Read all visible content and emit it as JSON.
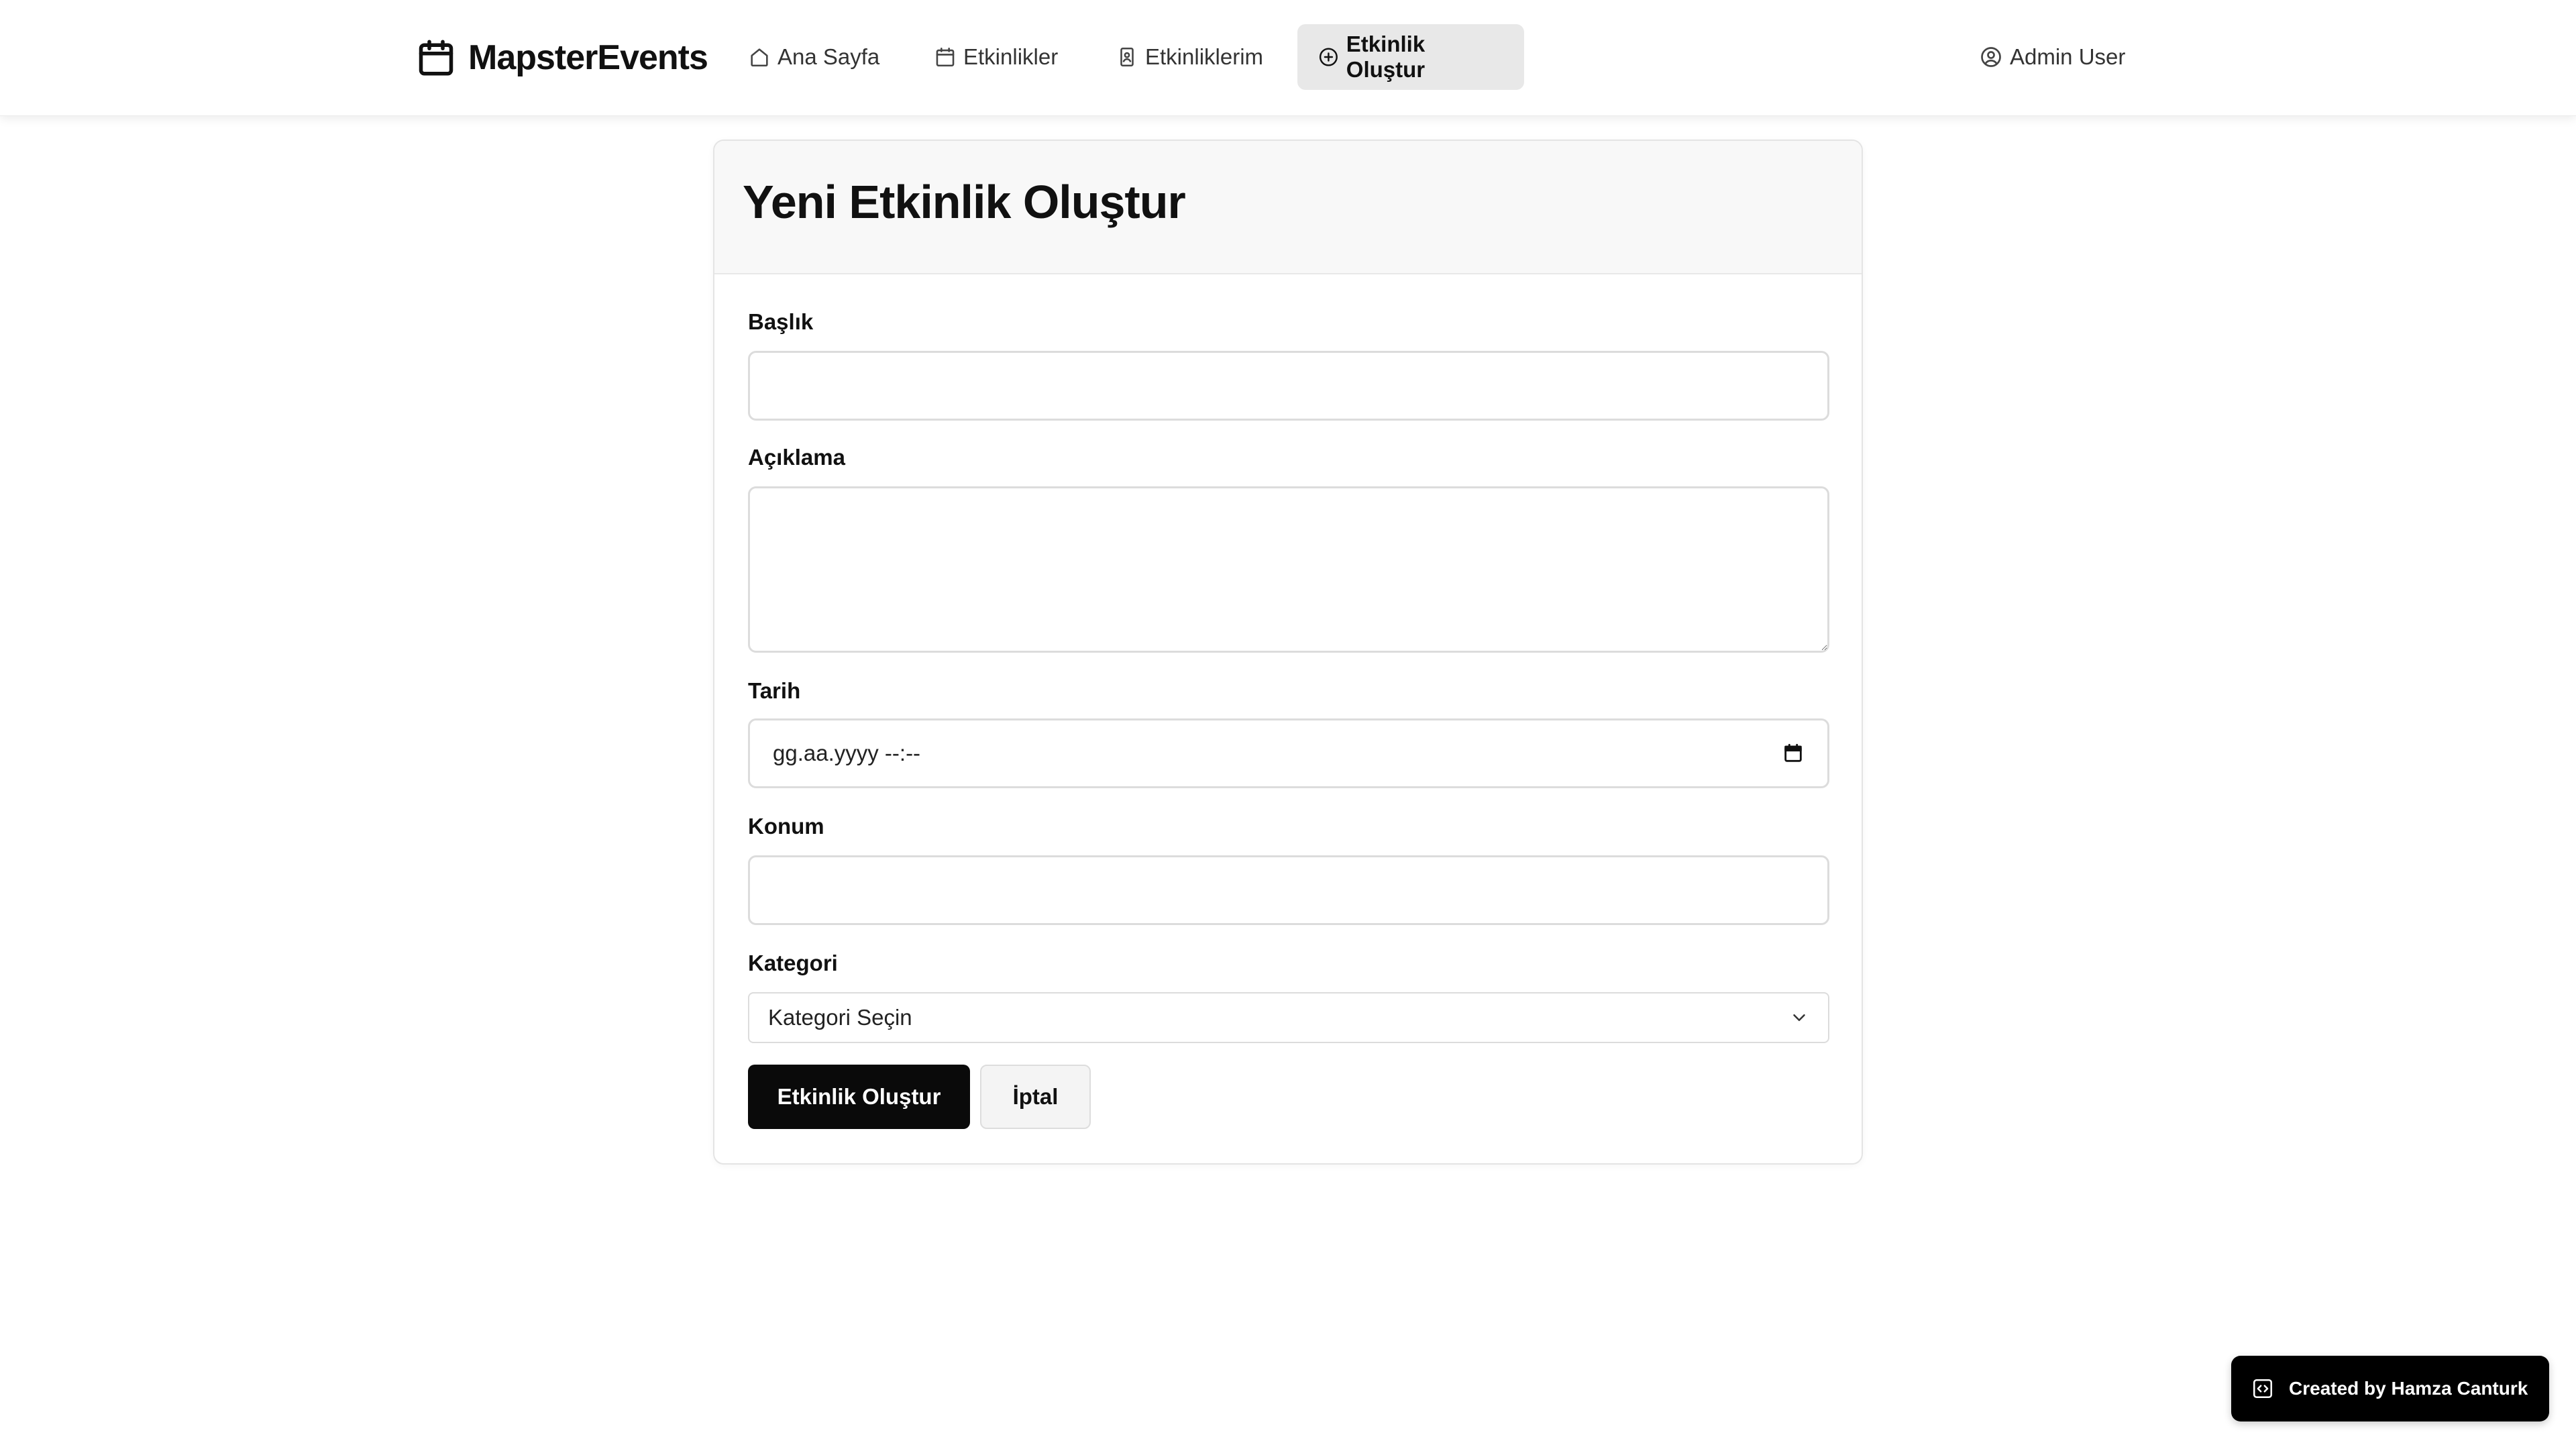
{
  "brand": {
    "name": "MapsterEvents",
    "icon": "calendar-icon"
  },
  "nav": {
    "items": [
      {
        "label": "Ana Sayfa",
        "icon": "home-icon"
      },
      {
        "label": "Etkinlikler",
        "icon": "calendar-icon"
      },
      {
        "label": "Etkinliklerim",
        "icon": "badge-icon"
      },
      {
        "label": "Etkinlik Oluştur",
        "icon": "plus-circle-icon",
        "active": true
      }
    ],
    "user": {
      "label": "Admin User",
      "icon": "user-circle-icon"
    }
  },
  "form": {
    "title": "Yeni Etkinlik Oluştur",
    "fields": {
      "title": {
        "label": "Başlık",
        "value": ""
      },
      "description": {
        "label": "Açıklama",
        "value": ""
      },
      "date": {
        "label": "Tarih",
        "value": "gg.aa.yyyy --:--",
        "icon": "calendar-icon"
      },
      "location": {
        "label": "Konum",
        "value": ""
      },
      "category": {
        "label": "Kategori",
        "selected": "Kategori Seçin",
        "icon": "chevron-down-icon"
      }
    },
    "buttons": {
      "submit": "Etkinlik Oluştur",
      "cancel": "İptal"
    }
  },
  "footer_badge": {
    "label": "Created by Hamza Canturk",
    "icon": "code-icon"
  },
  "colors": {
    "primary": "#0a0a0a",
    "active_nav_bg": "#e8e8e8",
    "border": "#dcdcdc",
    "card_header_bg": "#f8f8f8"
  }
}
